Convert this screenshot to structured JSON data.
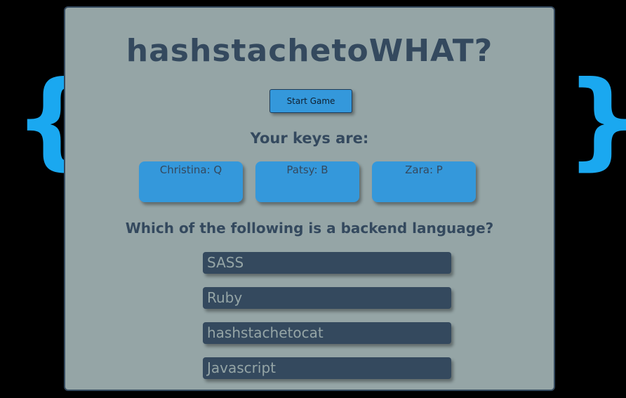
{
  "braces": {
    "left": "{",
    "right": "}"
  },
  "title": "hashstachetoWHAT?",
  "start_button": "Start Game",
  "keys_heading": "Your keys are:",
  "players": [
    {
      "label": "Christina: Q"
    },
    {
      "label": "Patsy: B"
    },
    {
      "label": "Zara: P"
    }
  ],
  "question": "Which of the following is a backend language?",
  "answers": [
    {
      "label": "SASS"
    },
    {
      "label": "Ruby"
    },
    {
      "label": "hashstachetocat"
    },
    {
      "label": "Javascript"
    }
  ],
  "colors": {
    "page_background": "#000000",
    "board_background": "#95a5a6",
    "text_dark": "#34495e",
    "accent_blue": "#3498db",
    "brace_blue": "#1aa8f0"
  }
}
